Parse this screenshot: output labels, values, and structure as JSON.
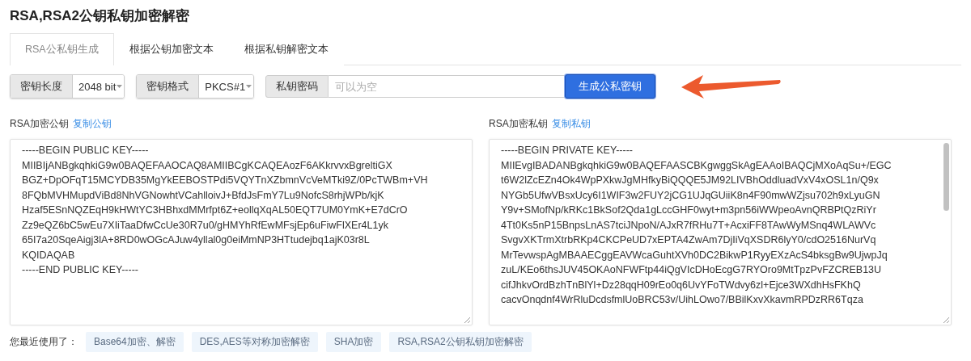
{
  "title": "RSA,RSA2公钥私钥加密解密",
  "tabs": [
    {
      "label": "RSA公私钥生成",
      "selected": true
    },
    {
      "label": "根据公钥加密文本",
      "selected": false
    },
    {
      "label": "根据私钥解密文本",
      "selected": false
    }
  ],
  "controls": [
    {
      "kind": "select",
      "label": "密钥长度",
      "value": "2048 bit"
    },
    {
      "kind": "select",
      "label": "密钥格式",
      "value": "PKCS#1"
    },
    {
      "kind": "input",
      "label": "私钥密码",
      "placeholder": "可以为空"
    }
  ],
  "generate_button": "生成公私密钥",
  "panels": [
    {
      "label": "RSA加密公钥",
      "link": "复制公钥",
      "scrollbar": false,
      "lines": [
        "-----BEGIN PUBLIC KEY-----",
        "MIIBIjANBgkqhkiG9w0BAQEFAAOCAQ8AMIIBCgKCAQEAozF6AKkrvvxBgreltiGX",
        "BGZ+DpOFqT15MCYDB35MgYkEEBOSTPdi5VQYTnXZbmnVcVeMTki9Z/0PcTWBm+VH",
        "8FQbMVHMupdViBd8NhVGNowhtVCahlloivJ+BfdJsFmY7Lu9NofcS8rhjWPb/kjK",
        "Hzaf5ESnNQZEqH9kHWtYC3HBhxdMMrfpt6Z+eollqXqAL50EQT7UM0YmK+E7dCrO",
        "Zz9eQZ6bC5wEu7XIiTaaDfwCcUe30R7u0/gHMYhRfEwMFsjEp6uFiwFlXEr4L1yk",
        "65I7a20SqeAigj3lA+8RD0wOGcAJuw4yllal0g0eiMmNP3HTtudejbq1ajK03r8L",
        "KQIDAQAB",
        "-----END PUBLIC KEY-----"
      ]
    },
    {
      "label": "RSA加密私钥",
      "link": "复制私钥",
      "scrollbar": true,
      "lines": [
        "-----BEGIN PRIVATE KEY-----",
        "MIIEvgIBADANBgkqhkiG9w0BAQEFAASCBKgwggSkAgEAAoIBAQCjMXoAqSu+/EGC",
        "t6W2lZcEZn4Ok4WpPXkwJgMHfkyBiQQQE5JM92LIVBhOddluadVxV4xOSL1n/Q9x",
        "NYGb5UfwVBsxUcy6I1WIF3w2FUY2jCG1UJqGUiiK8n4F90mwWZjsu702h9xLyuGN",
        "Y9v+SMofNp/kRKc1BkSof2Qda1gLccGHF0wyt+m3pn56iWWpeoAvnQRBPtQzRiYr",
        "4Tt0Ks5nP15BnpsLnAS7tciJNpoN/AJxR7fRHu7T+AcxiFF8TAwWyMSnq4WLAWVc",
        "SvgvXKTrmXtrbRKp4CKCPeUD7xEPTA4ZwAm7DjIiVqXSDR6lyY0/cdO2516NurVq",
        "MrTevwspAgMBAAECggEAVWcaGuhtXVh0DC2BikwP1RyyEXzAcS4bksgBw9UjwpJq",
        "zuL/KEo6thsJUV45OKAoNFWFtp44iQgVIcDHoEcgG7RYOro9MtTpzPvFZCREB13U",
        "cifJhkvOrdBzhTnBlYl+Dz28qqH09rEo0q6UvYFoTWdvy6zl+Ejce3WXdhHsFKhQ",
        "cacvOnqdnf4WrRluDcdsfmlUoBRC53v/UihLOwo7/BBilKxvXkavmRPDzRR6Tqza"
      ]
    }
  ],
  "recent": {
    "label": "您最近使用了：",
    "items": [
      "Base64加密、解密",
      "DES,AES等对称加密解密",
      "SHA加密",
      "RSA,RSA2公钥私钥加密解密"
    ]
  }
}
